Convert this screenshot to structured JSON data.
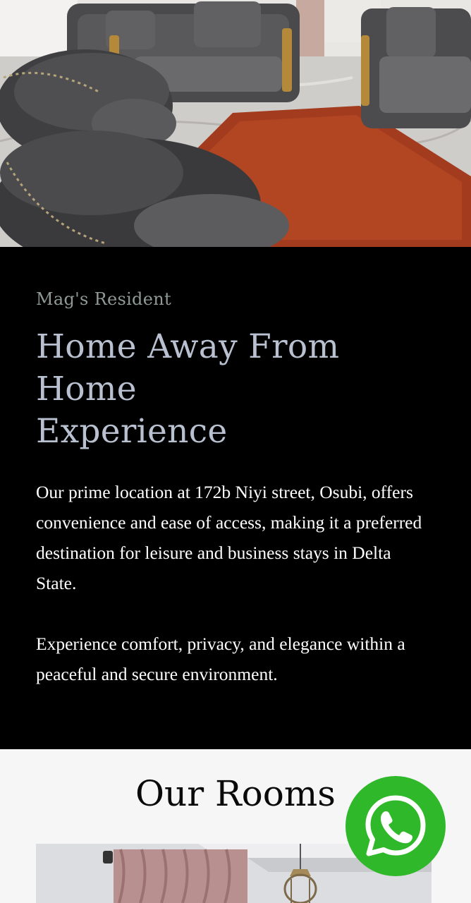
{
  "hero": {
    "image_icon": "living-room-photo-icon"
  },
  "about": {
    "eyebrow": "Mag's Resident",
    "headline_line1": "Home Away From Home",
    "headline_line2": "Experience",
    "paragraph1": "Our prime location at 172b Niyi street, Osubi, offers convenience and ease of access, making it a preferred destination for leisure and business stays in Delta State.",
    "paragraph2": "Experience comfort, privacy, and elegance within a peaceful and secure environment."
  },
  "rooms": {
    "title": "Our Rooms",
    "photo_icon": "bedroom-photo-icon"
  },
  "whatsapp": {
    "icon": "whatsapp-icon",
    "color": "#2fb82a"
  },
  "colors": {
    "about_background": "#000000",
    "eyebrow": "#8f9a96",
    "headline": "#b9c1d1",
    "body_text": "#ffffff",
    "rooms_background": "#f6f6f6"
  }
}
